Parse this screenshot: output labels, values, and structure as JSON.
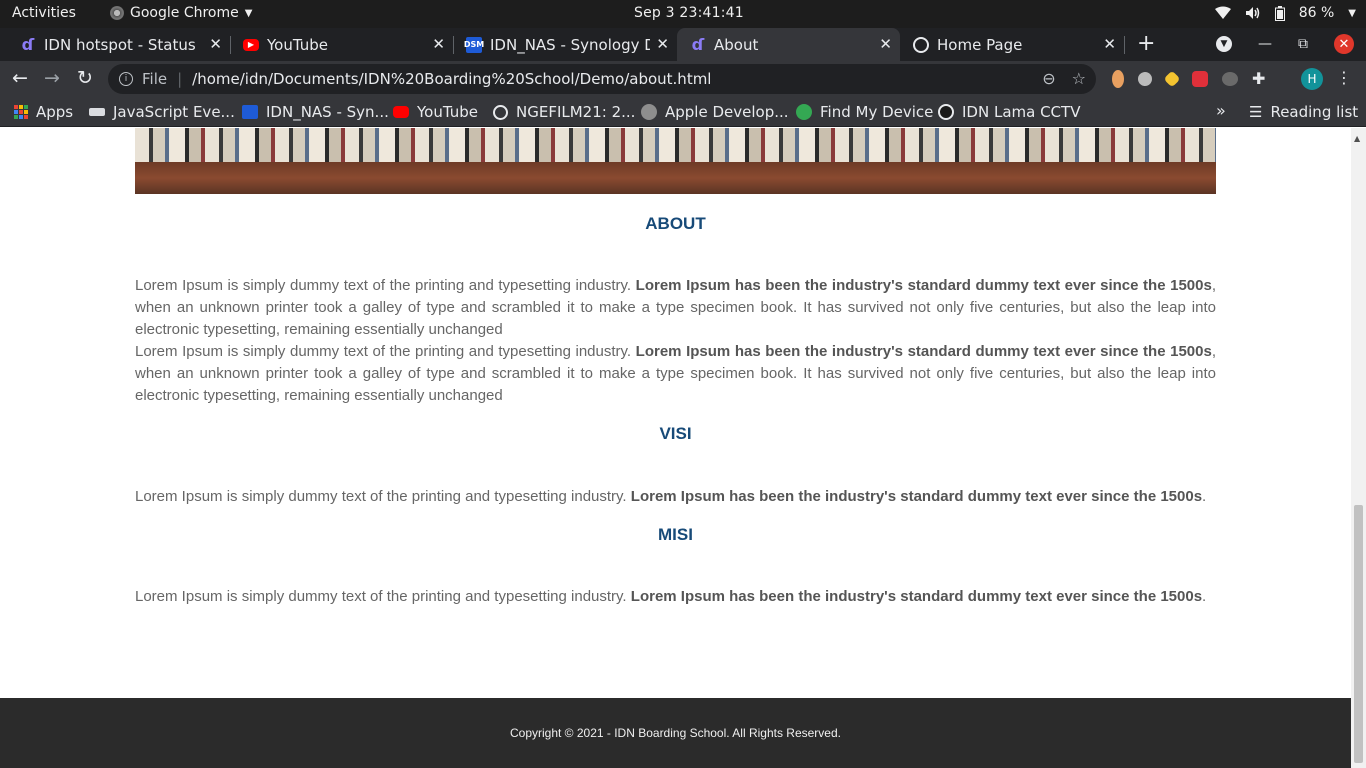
{
  "system_bar": {
    "activities": "Activities",
    "app_name": "Google Chrome",
    "clock": "Sep 3  23:41:41",
    "battery": "86 %"
  },
  "tabs": [
    {
      "title": "IDN hotspot - Status",
      "icon": "idn-logo-icon"
    },
    {
      "title": "YouTube",
      "icon": "youtube-icon"
    },
    {
      "title": "IDN_NAS - Synology Dis",
      "icon": "dsm-icon"
    },
    {
      "title": "About",
      "icon": "idn-logo-icon",
      "active": true
    },
    {
      "title": "Home Page",
      "icon": "globe-icon"
    }
  ],
  "omnibox": {
    "scheme": "File",
    "url": "/home/idn/Documents/IDN%20Boarding%20School/Demo/about.html"
  },
  "profile_initial": "H",
  "bookmarks": [
    {
      "label": "Apps"
    },
    {
      "label": "JavaScript Eve..."
    },
    {
      "label": "IDN_NAS - Syn..."
    },
    {
      "label": "YouTube"
    },
    {
      "label": "NGEFILM21: 2..."
    },
    {
      "label": "Apple Develop..."
    },
    {
      "label": "Find My Device"
    },
    {
      "label": "IDN Lama CCTV"
    }
  ],
  "reading_list": "Reading list",
  "page": {
    "about": {
      "title": "ABOUT",
      "p1_normal": "Lorem Ipsum is simply dummy text of the printing and typesetting industry. ",
      "p1_bold": "Lorem Ipsum has been the industry's standard dummy text ever since the 1500s",
      "p1_rest": ", when an unknown printer took a galley of type and scrambled it to make a type specimen book. It has survived not only five centuries, but also the leap into electronic typesetting, remaining essentially unchanged",
      "p2_normal": "Lorem Ipsum is simply dummy text of the printing and typesetting industry. ",
      "p2_bold": "Lorem Ipsum has been the industry's standard dummy text ever since the 1500s",
      "p2_rest": ", when an unknown printer took a galley of type and scrambled it to make a type specimen book. It has survived not only five centuries, but also the leap into electronic typesetting, remaining essentially unchanged"
    },
    "visi": {
      "title": "VISI",
      "normal": "Lorem Ipsum is simply dummy text of the printing and typesetting industry. ",
      "bold": "Lorem Ipsum has been the industry's standard dummy text ever since the 1500s",
      "end": "."
    },
    "misi": {
      "title": "MISI",
      "normal": "Lorem Ipsum is simply dummy text of the printing and typesetting industry. ",
      "bold": "Lorem Ipsum has been the industry's standard dummy text ever since the 1500s",
      "end": "."
    },
    "footer": "Copyright © 2021 - IDN Boarding School. All Rights Reserved."
  }
}
